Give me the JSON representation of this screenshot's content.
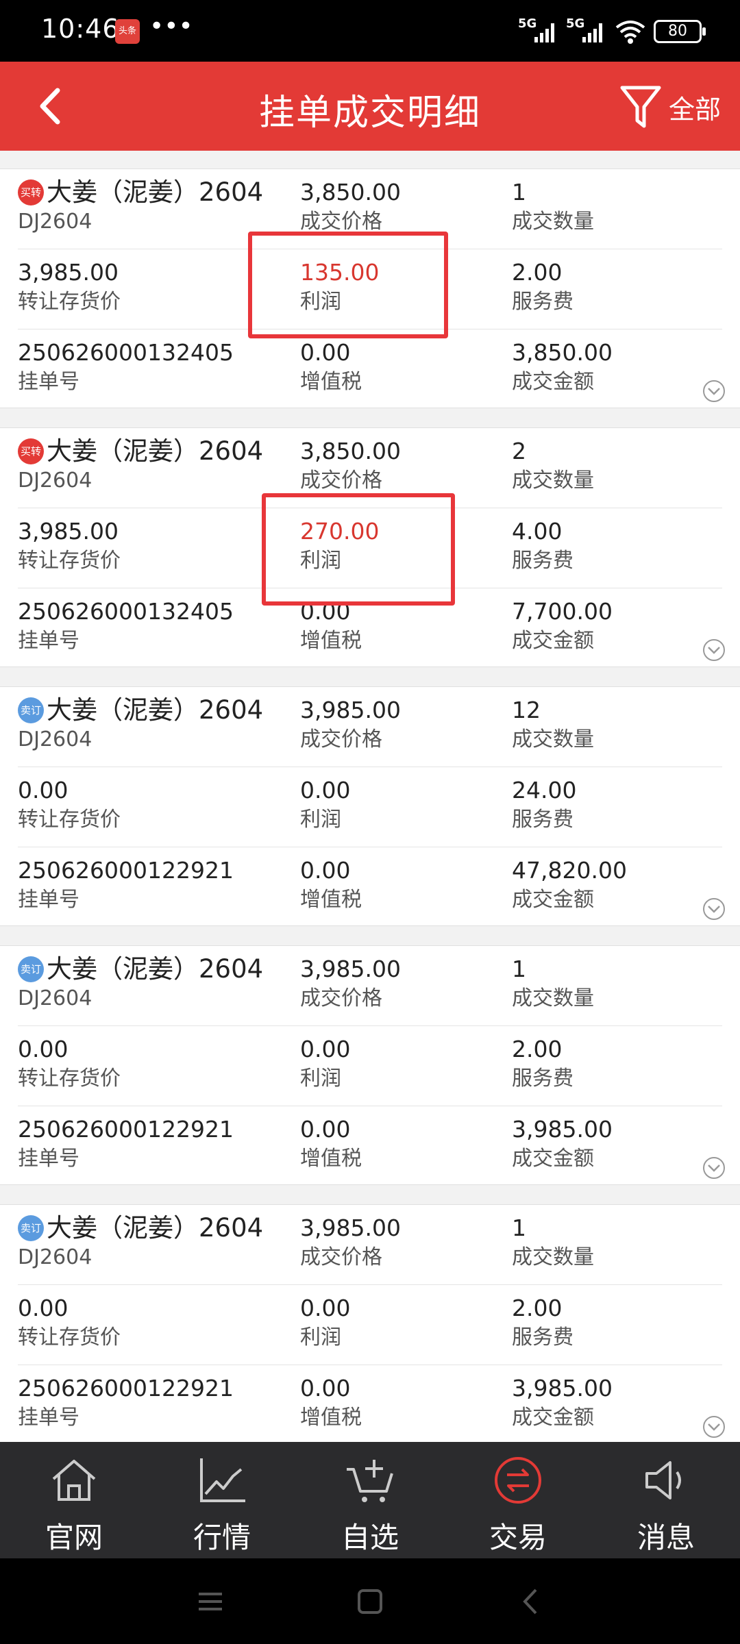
{
  "status_bar": {
    "time": "10:46",
    "app_badge": "头条",
    "dots": "•••",
    "network1": "5G",
    "network2": "5G",
    "battery": "80"
  },
  "header": {
    "title": "挂单成交明细",
    "filter_label": "全部"
  },
  "colors": {
    "header_bg": "#e33a36",
    "profit_red": "#d8372f",
    "highlight": "#e8363a",
    "buy_badge": "#e33a36",
    "sell_badge": "#5b9bdf",
    "nav_bg": "#2b2b2d"
  },
  "labels": {
    "price": "成交价格",
    "qty": "成交数量",
    "transfer": "转让存货价",
    "profit": "利润",
    "fee": "服务费",
    "order_no": "挂单号",
    "vat": "增值税",
    "amount": "成交金额"
  },
  "orders": [
    {
      "badge": "买转",
      "badge_type": "buy",
      "name": "大姜（泥姜）2604",
      "code": "DJ2604",
      "price": "3,850.00",
      "qty": "1",
      "transfer_price": "3,985.00",
      "profit": "135.00",
      "profit_red": true,
      "fee": "2.00",
      "order_no": "250626000132405",
      "vat": "0.00",
      "amount": "3,850.00"
    },
    {
      "badge": "买转",
      "badge_type": "buy",
      "name": "大姜（泥姜）2604",
      "code": "DJ2604",
      "price": "3,850.00",
      "qty": "2",
      "transfer_price": "3,985.00",
      "profit": "270.00",
      "profit_red": true,
      "fee": "4.00",
      "order_no": "250626000132405",
      "vat": "0.00",
      "amount": "7,700.00"
    },
    {
      "badge": "卖订",
      "badge_type": "sell",
      "name": "大姜（泥姜）2604",
      "code": "DJ2604",
      "price": "3,985.00",
      "qty": "12",
      "transfer_price": "0.00",
      "profit": "0.00",
      "profit_red": false,
      "fee": "24.00",
      "order_no": "250626000122921",
      "vat": "0.00",
      "amount": "47,820.00"
    },
    {
      "badge": "卖订",
      "badge_type": "sell",
      "name": "大姜（泥姜）2604",
      "code": "DJ2604",
      "price": "3,985.00",
      "qty": "1",
      "transfer_price": "0.00",
      "profit": "0.00",
      "profit_red": false,
      "fee": "2.00",
      "order_no": "250626000122921",
      "vat": "0.00",
      "amount": "3,985.00"
    },
    {
      "badge": "卖订",
      "badge_type": "sell",
      "name": "大姜（泥姜）2604",
      "code": "DJ2604",
      "price": "3,985.00",
      "qty": "1",
      "transfer_price": "0.00",
      "profit": "0.00",
      "profit_red": false,
      "fee": "2.00",
      "order_no": "250626000122921",
      "vat": "0.00",
      "amount": "3,985.00"
    }
  ],
  "bottom_nav": [
    {
      "label": "官网",
      "icon": "home-icon",
      "active": false
    },
    {
      "label": "行情",
      "icon": "chart-icon",
      "active": false
    },
    {
      "label": "自选",
      "icon": "cart-add-icon",
      "active": false
    },
    {
      "label": "交易",
      "icon": "exchange-icon",
      "active": true
    },
    {
      "label": "消息",
      "icon": "speaker-icon",
      "active": false
    }
  ]
}
